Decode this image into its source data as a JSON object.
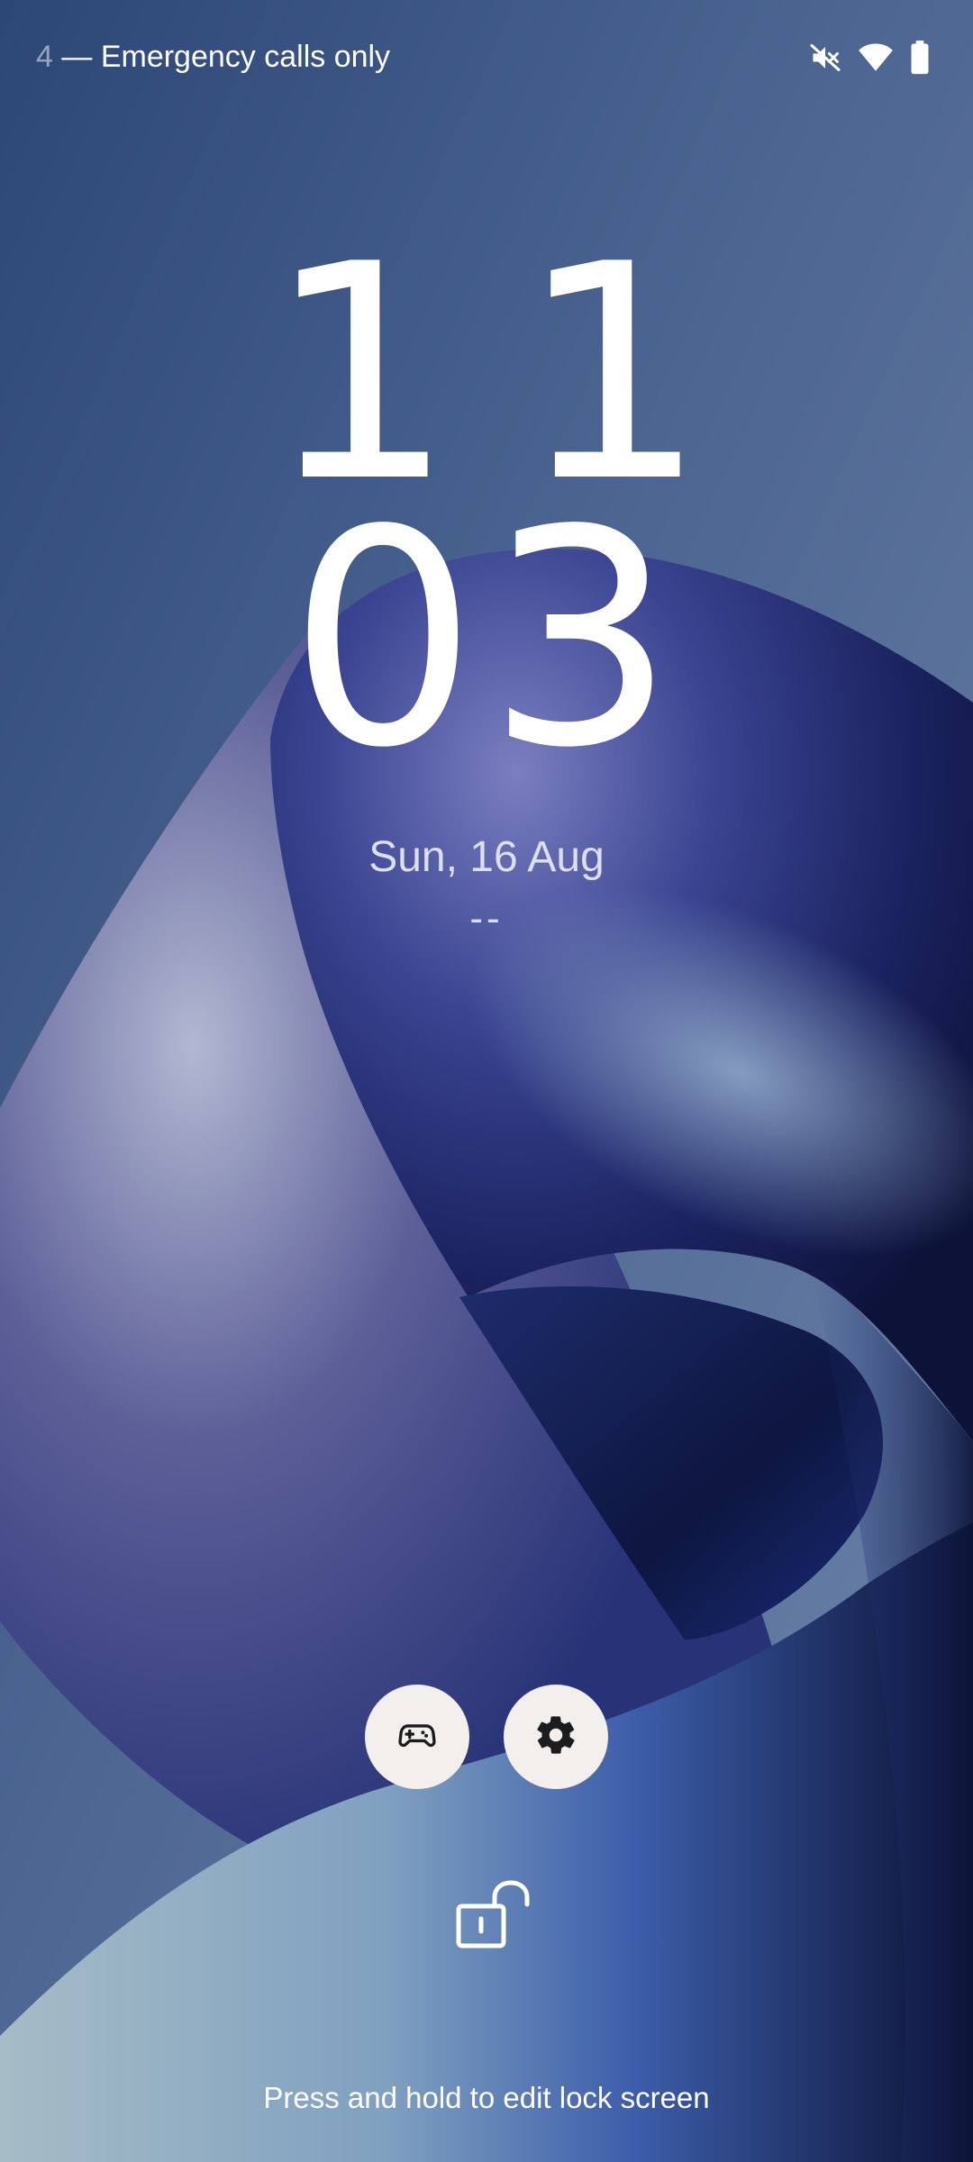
{
  "status_bar": {
    "carrier_prefix": "4",
    "carrier_text": "— Emergency calls only",
    "icons": [
      "mute-icon",
      "wifi-icon",
      "battery-icon"
    ]
  },
  "clock": {
    "hours": "11",
    "minutes": "03"
  },
  "date": "Sun, 16 Aug",
  "weather": "--",
  "shortcuts": [
    {
      "name": "game-controller-icon"
    },
    {
      "name": "gear-icon"
    }
  ],
  "unlock_icon": "unlock-icon",
  "hint_text": "Press and hold to edit lock screen",
  "colors": {
    "background": "#3f5a86",
    "shortcut_bg": "#f2efec",
    "text": "#ffffff"
  }
}
